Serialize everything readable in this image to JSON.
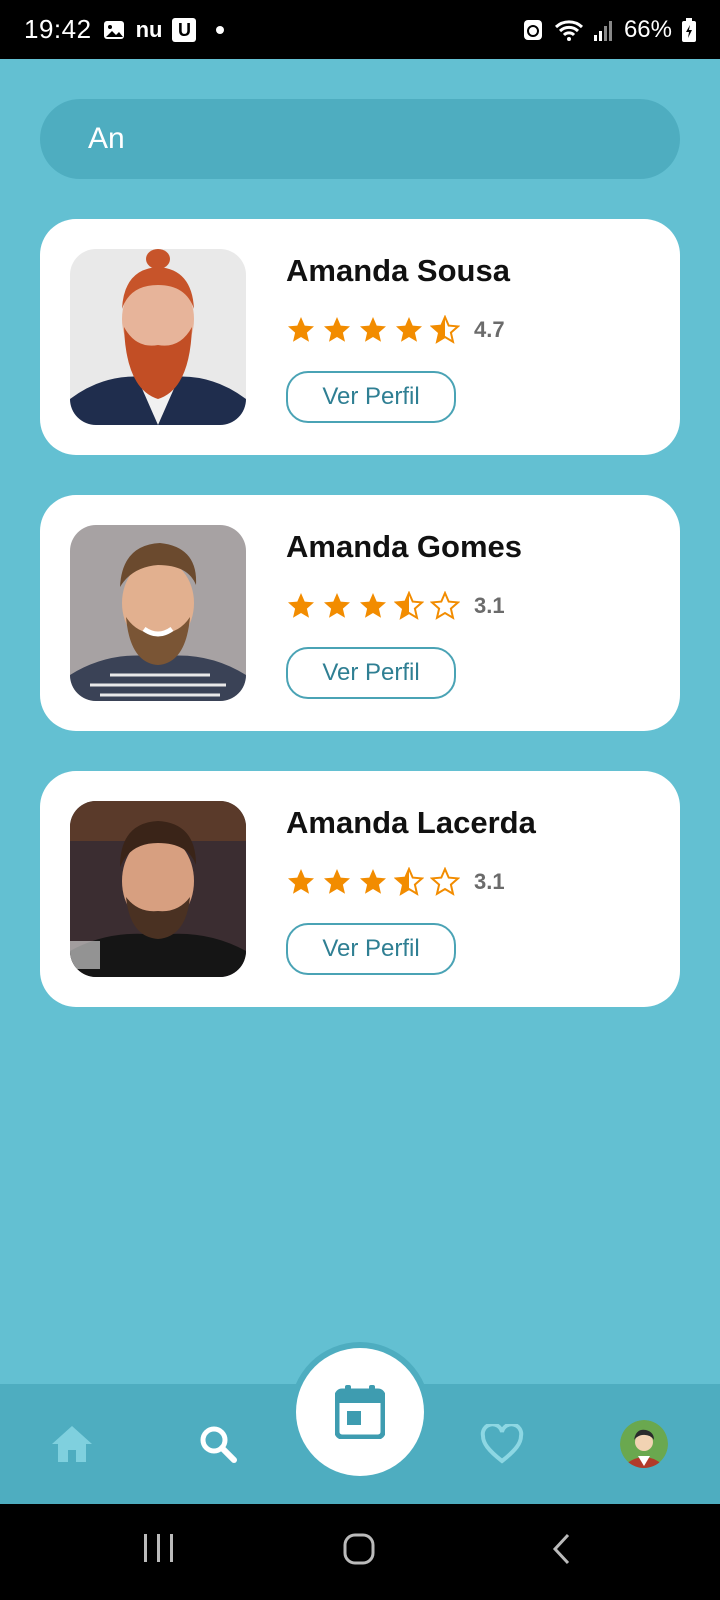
{
  "status_bar": {
    "time": "19:42",
    "carrier_text": "nu",
    "u_badge": "U",
    "battery": "66%"
  },
  "search": {
    "value": "An"
  },
  "results": [
    {
      "name": "Amanda Sousa",
      "rating": "4.7",
      "stars": 4.7,
      "button": "Ver Perfil"
    },
    {
      "name": "Amanda Gomes",
      "rating": "3.1",
      "stars": 3.5,
      "button": "Ver Perfil"
    },
    {
      "name": "Amanda Lacerda",
      "rating": "3.1",
      "stars": 3.5,
      "button": "Ver Perfil"
    }
  ],
  "bottom_nav": {
    "items": [
      "home-icon",
      "search-icon",
      "calendar-icon",
      "heart-icon",
      "profile-avatar"
    ],
    "accent": "#4eadc0",
    "fab_icon_color": "#3e9cb0"
  },
  "colors": {
    "background": "#63c0d2",
    "star": "#f28c00",
    "button_border": "#4aa3b5"
  }
}
